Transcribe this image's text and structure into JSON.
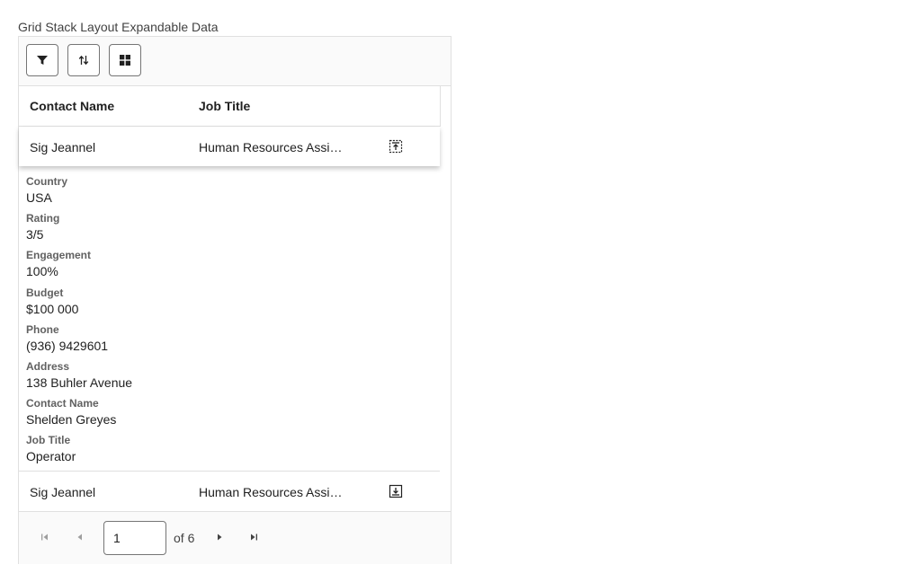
{
  "page": {
    "title": "Grid Stack Layout Expandable Data"
  },
  "toolbar": {
    "buttons": [
      {
        "name": "filter-button",
        "icon": "filter-icon"
      },
      {
        "name": "sort-button",
        "icon": "sort-icon"
      },
      {
        "name": "layout-button",
        "icon": "grid-layout-icon"
      }
    ]
  },
  "columns": [
    "Contact Name",
    "Job Title"
  ],
  "rows": [
    {
      "contact_name": "Sig Jeannel",
      "job_title": "Human Resources Assistant IV",
      "expanded": true,
      "expand_icon": "collapse-row-icon"
    },
    {
      "contact_name": "Sig Jeannel",
      "job_title": "Human Resources Assistant IV",
      "expanded": false,
      "expand_icon": "expand-row-icon"
    }
  ],
  "details": [
    {
      "label": "Country",
      "value": "USA"
    },
    {
      "label": "Rating",
      "value": "3/5"
    },
    {
      "label": "Engagement",
      "value": "100%"
    },
    {
      "label": "Budget",
      "value": "$100 000"
    },
    {
      "label": "Phone",
      "value": "(936) 9429601"
    },
    {
      "label": "Address",
      "value": "138 Buhler Avenue"
    },
    {
      "label": "Contact Name",
      "value": "Shelden Greyes"
    },
    {
      "label": "Job Title",
      "value": "Operator"
    }
  ],
  "pager": {
    "current_page": "1",
    "of_text": "of 6"
  },
  "colors": {
    "border": "#e0e0e0",
    "toolbar_bg": "#fafafa",
    "text": "#212121",
    "label": "#616161"
  }
}
